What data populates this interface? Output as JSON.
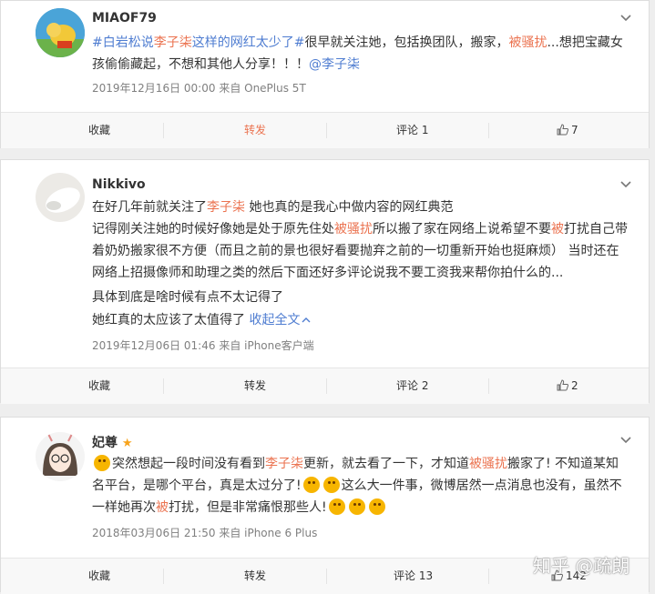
{
  "posts": [
    {
      "name": "MIAOF79",
      "text": [
        {
          "t": "#白岩松说",
          "c": "lk"
        },
        {
          "t": "李子柒",
          "c": "hl"
        },
        {
          "t": "这样的网红太少了#",
          "c": "lk"
        },
        {
          "t": "很早就关注她，包括换团队，搬家，",
          "c": ""
        },
        {
          "t": "被骚扰",
          "c": "hl"
        },
        {
          "t": "...想把宝藏女孩偷偷藏起，不想和其他人分享！！！",
          "c": ""
        },
        {
          "t": "@李子柒",
          "c": "lk"
        }
      ],
      "time": "2019年12月16日 00:00",
      "source": "来自 OnePlus 5T",
      "actions": {
        "fav": "收藏",
        "repost": "转发",
        "comment": "评论 1",
        "likes": "7"
      }
    },
    {
      "name": "Nikkivo",
      "text1": [
        {
          "t": "在好几年前就关注了",
          "c": ""
        },
        {
          "t": "李子柒",
          "c": "hl"
        },
        {
          "t": " 她也真的是我心中做内容的网红典范",
          "c": ""
        }
      ],
      "text2": [
        {
          "t": "记得刚关注她的时候好像她是处于原先住处",
          "c": ""
        },
        {
          "t": "被骚扰",
          "c": "hl"
        },
        {
          "t": "所以搬了家在网络上说希望不要",
          "c": ""
        },
        {
          "t": "被",
          "c": "hl"
        },
        {
          "t": "打扰自己带着奶奶搬家很不方便（而且之前的景也很好看要抛弃之前的一切重新开始也挺麻烦） 当时还在网络上招摄像师和助理之类的然后下面还好多评论说我不要工资我来帮你拍什么的...",
          "c": ""
        }
      ],
      "text3": "具体到底是啥时候有点不太记得了",
      "text4": "她红真的太应该了太值得了",
      "collapse": "收起全文",
      "time": "2019年12月06日 01:46",
      "source": "来自 iPhone客户端",
      "actions": {
        "fav": "收藏",
        "repost": "转发",
        "comment": "评论 2",
        "likes": "2"
      }
    },
    {
      "name": "妃尊",
      "text": [
        {
          "t": "突然想起一段时间没有看到",
          "c": ""
        },
        {
          "t": "李子柒",
          "c": "hl"
        },
        {
          "t": "更新，就去看了一下，才知道",
          "c": ""
        },
        {
          "t": "被骚扰",
          "c": "hl"
        },
        {
          "t": "搬家了! 不知道某知名平台，是哪个平台，真是太过分了!",
          "c": ""
        }
      ],
      "text_b": [
        {
          "t": "这么大一件事，微博居然一点消息也没有，虽然不一样她再次",
          "c": ""
        },
        {
          "t": "被",
          "c": "hl"
        },
        {
          "t": "打扰，但是非常痛恨那些人!",
          "c": ""
        }
      ],
      "time": "2018年03月06日 21:50",
      "source": "来自 iPhone 6 Plus",
      "actions": {
        "fav": "收藏",
        "repost": "转发",
        "comment": "评论 13",
        "likes": "142"
      }
    }
  ],
  "watermark": "知乎 @疏朗",
  "colors": {
    "highlight": "#eb7350",
    "link": "#4f7dd1",
    "vip_star": "#f7a31c"
  }
}
